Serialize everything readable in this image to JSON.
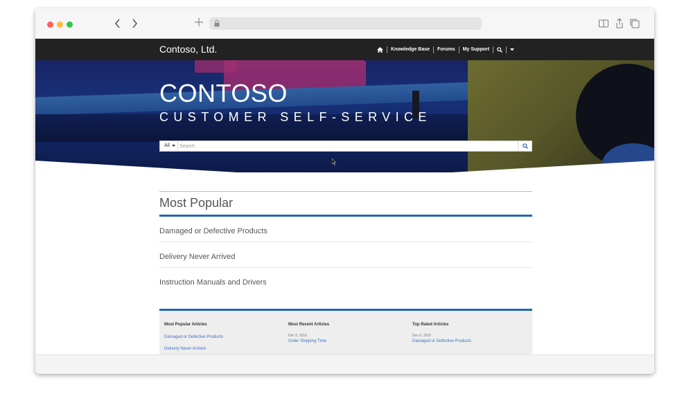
{
  "brand": {
    "name": "Contoso, Ltd."
  },
  "topnav": {
    "home_icon": "home-icon",
    "items": [
      "Knowledge Base",
      "Forums",
      "My Support"
    ],
    "search_icon": "search-icon",
    "dropdown_icon": "caret-down-icon"
  },
  "hero": {
    "title": "CONTOSO",
    "subtitle": "CUSTOMER SELF-SERVICE"
  },
  "search": {
    "filter_label": "All",
    "placeholder": "Search"
  },
  "most_popular": {
    "title": "Most Popular",
    "items": [
      "Damaged or Defective Products",
      "Delivery Never Arrived",
      "Instruction Manuals and Drivers"
    ]
  },
  "articles": {
    "popular": {
      "heading": "Most Popular Articles",
      "links": [
        "Damaged or Defective Products",
        "Delivery Never Arrived"
      ]
    },
    "recent": {
      "heading": "Most Recent Articles",
      "date": "Dec 6, 2016",
      "link": "Order Shipping Time"
    },
    "top_rated": {
      "heading": "Top Rated Articles",
      "date": "Dec 6, 2016",
      "link": "Damaged or Defective Products"
    }
  },
  "colors": {
    "header_bg": "#222222",
    "accent_blue": "#2366b0",
    "link_blue": "#3a72c2"
  }
}
